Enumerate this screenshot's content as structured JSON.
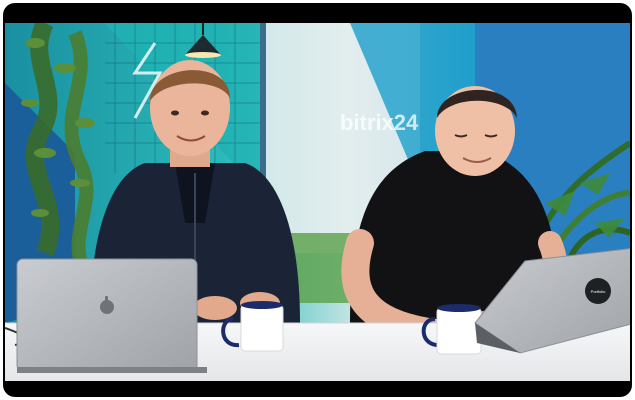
{
  "video": {
    "wall_brand_text": "bitrix24",
    "laptop_sticker_text": "Portfolio",
    "colors": {
      "teal": "#1fb3b8",
      "deep_teal": "#0e7f86",
      "wall_blue": "#2a7fc0",
      "desk": "#f1f2f4",
      "frame": "#000000"
    }
  }
}
